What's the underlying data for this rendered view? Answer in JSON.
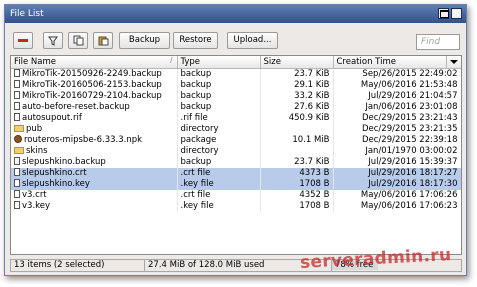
{
  "window": {
    "title": "File List"
  },
  "toolbar": {
    "remove_icon": "minus-icon",
    "filter_icon": "filter-icon",
    "copy_icon": "copy-icon",
    "paste_icon": "paste-icon",
    "backup_label": "Backup",
    "restore_label": "Restore",
    "upload_label": "Upload...",
    "find_placeholder": "Find"
  },
  "table": {
    "columns": [
      "File Name",
      "Type",
      "Size",
      "Creation Time"
    ],
    "rows": [
      {
        "name": "MikroTik-20150926-2249.backup",
        "type": "backup",
        "size": "23.7 KiB",
        "time": "Sep/26/2015 22:49:02",
        "icon": "file",
        "selected": false
      },
      {
        "name": "MikroTik-20160506-2153.backup",
        "type": "backup",
        "size": "29.1 KiB",
        "time": "May/06/2016 21:53:48",
        "icon": "file",
        "selected": false
      },
      {
        "name": "MikroTik-20160729-2104.backup",
        "type": "backup",
        "size": "33.2 KiB",
        "time": "Jul/29/2016 21:04:57",
        "icon": "file",
        "selected": false
      },
      {
        "name": "auto-before-reset.backup",
        "type": "backup",
        "size": "27.6 KiB",
        "time": "Jan/06/2016 23:01:08",
        "icon": "file",
        "selected": false
      },
      {
        "name": "autosupout.rif",
        "type": ".rif file",
        "size": "450.9 KiB",
        "time": "Dec/29/2015 23:21:43",
        "icon": "file",
        "selected": false
      },
      {
        "name": "pub",
        "type": "directory",
        "size": "",
        "time": "Dec/29/2015 23:21:35",
        "icon": "folder",
        "selected": false
      },
      {
        "name": "routeros-mipsbe-6.33.3.npk",
        "type": "package",
        "size": "10.1 MiB",
        "time": "Dec/29/2015 22:39:18",
        "icon": "package",
        "selected": false
      },
      {
        "name": "skins",
        "type": "directory",
        "size": "",
        "time": "Jan/01/1970 03:00:02",
        "icon": "folder",
        "selected": false
      },
      {
        "name": "slepushkino.backup",
        "type": "backup",
        "size": "23.7 KiB",
        "time": "Jul/29/2016 15:39:37",
        "icon": "file",
        "selected": false
      },
      {
        "name": "slepushkino.crt",
        "type": ".crt file",
        "size": "4373 B",
        "time": "Jul/29/2016 18:17:27",
        "icon": "file",
        "selected": true
      },
      {
        "name": "slepushkino.key",
        "type": ".key file",
        "size": "1708 B",
        "time": "Jul/29/2016 18:17:30",
        "icon": "file",
        "selected": true
      },
      {
        "name": "v3.crt",
        "type": ".crt file",
        "size": "4352 B",
        "time": "May/06/2016 17:06:26",
        "icon": "file",
        "selected": false
      },
      {
        "name": "v3.key",
        "type": ".key file",
        "size": "1708 B",
        "time": "May/06/2016 17:06:23",
        "icon": "file",
        "selected": false
      }
    ]
  },
  "status": {
    "items": "13 items (2 selected)",
    "usage": "27.4 MiB of 128.0 MiB used",
    "free": "78% free"
  },
  "watermark": "serveradmin.ru",
  "colors": {
    "selection": "#b8cbe8",
    "titlebar": "#4a6aa0",
    "remove": "#d71d1d"
  }
}
